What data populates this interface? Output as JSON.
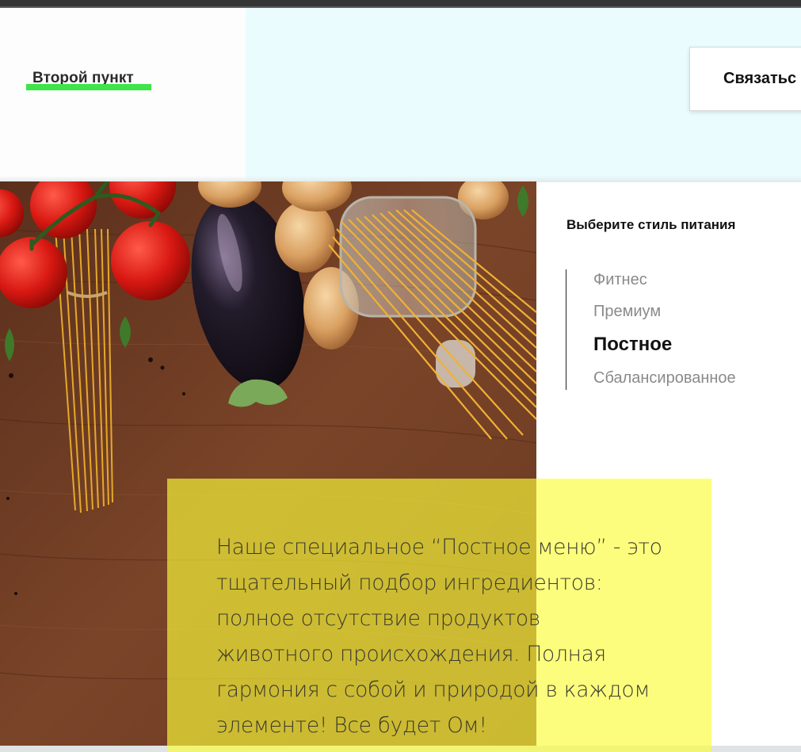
{
  "header": {
    "nav_item_label": "Второй пункт",
    "contact_button_label": "Связатьс",
    "accent_color": "#3fe449"
  },
  "sidebar": {
    "title": "Выберите стиль питания",
    "items": [
      {
        "label": "Фитнес",
        "active": false
      },
      {
        "label": "Премиум",
        "active": false
      },
      {
        "label": "Постное",
        "active": true
      },
      {
        "label": "Сбалансированное",
        "active": false
      }
    ]
  },
  "promo": {
    "lines": [
      "Наше специальное “Постное меню” - это",
      "тщательный подбор ингредиентов:",
      "полное отсутствие продуктов",
      "животного происхождения. Полная",
      "гармония с собой и природой в каждом",
      "элементе! Все будет Ом!"
    ],
    "background_color": "#fcfc3a"
  },
  "image": {
    "subject": "vegetables-and-pasta-on-wooden-table"
  }
}
